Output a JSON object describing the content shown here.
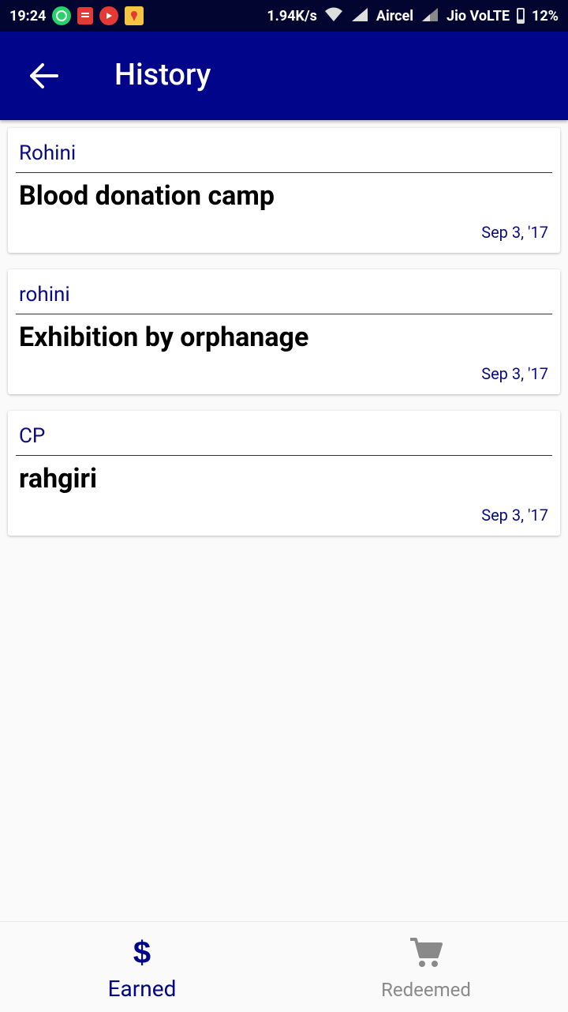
{
  "status_bar": {
    "time": "19:24",
    "speed": "1.94K/s",
    "carrier1": "Aircel",
    "carrier2": "Jio VoLTE",
    "battery": "12%"
  },
  "app_bar": {
    "title": "History"
  },
  "history": [
    {
      "location": "Rohini",
      "event": "Blood donation camp",
      "date": "Sep 3, '17"
    },
    {
      "location": "rohini",
      "event": "Exhibition by orphanage",
      "date": "Sep 3, '17"
    },
    {
      "location": "CP",
      "event": "rahgiri",
      "date": "Sep 3, '17"
    }
  ],
  "bottom_nav": {
    "earned_label": "Earned",
    "redeemed_label": "Redeemed",
    "active": "Earned"
  },
  "colors": {
    "app_bar": "#00058a",
    "accent_text": "#0a0a80",
    "inactive": "#8a8a8a"
  }
}
